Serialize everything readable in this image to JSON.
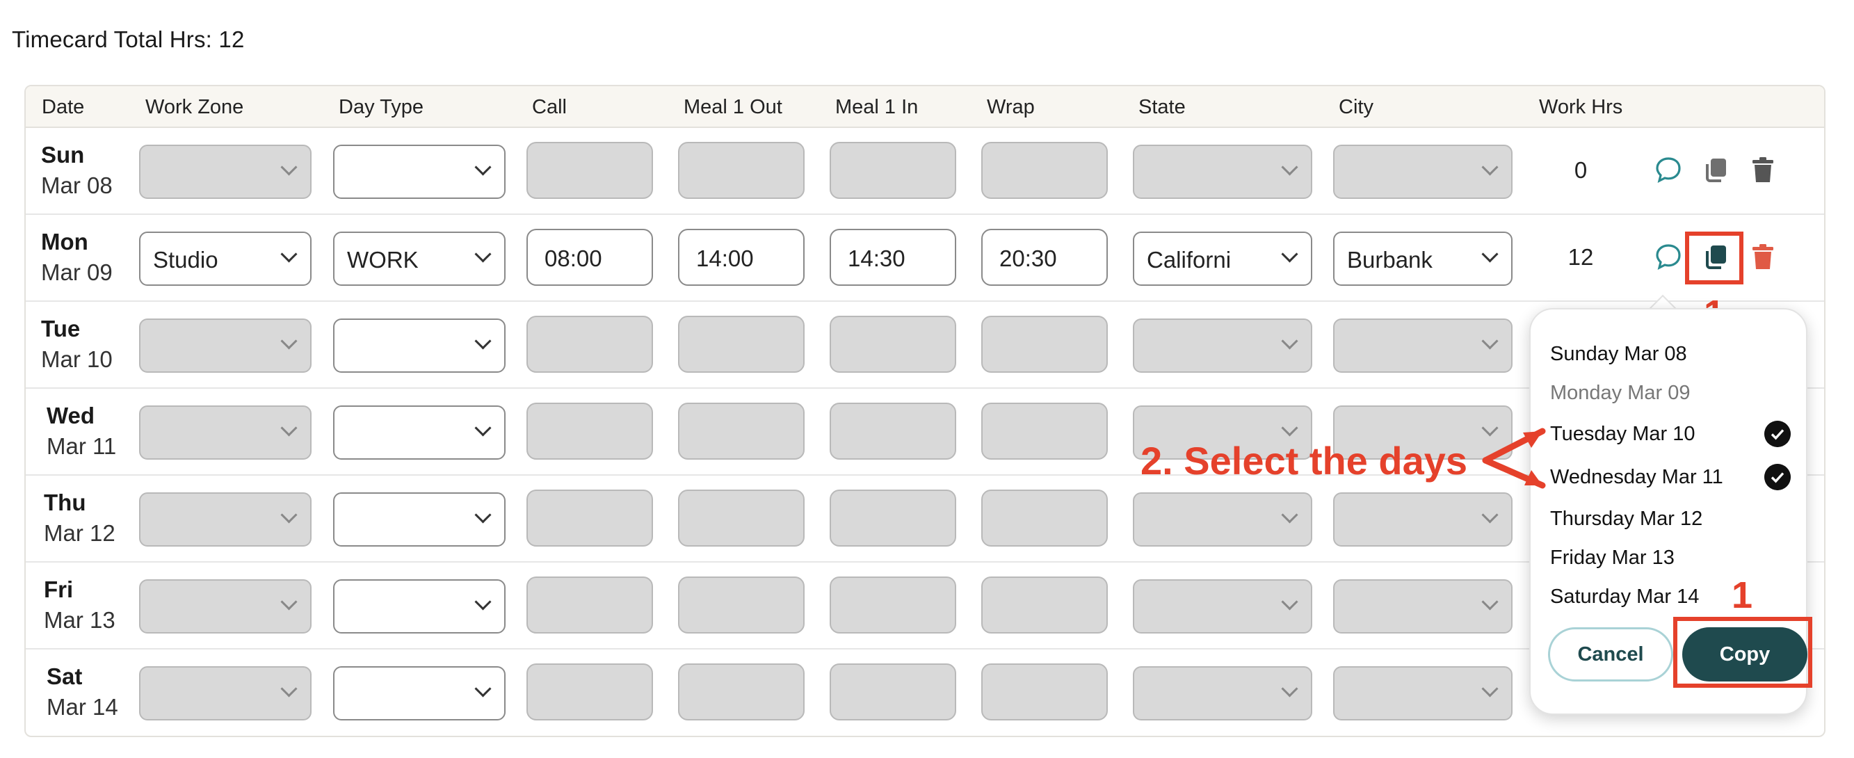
{
  "header": {
    "title": "Timecard Total Hrs: 12"
  },
  "columns": [
    "Date",
    "Work Zone",
    "Day Type",
    "Call",
    "Meal 1 Out",
    "Meal 1 In",
    "Wrap",
    "State",
    "City",
    "Work Hrs"
  ],
  "rows": [
    {
      "day": "Sun",
      "date": "Mar 08",
      "work_zone": "",
      "day_type": "",
      "call": "",
      "meal1_out": "",
      "meal1_in": "",
      "wrap": "",
      "state": "",
      "city": "",
      "work_hrs": "0"
    },
    {
      "day": "Mon",
      "date": "Mar 09",
      "work_zone": "Studio",
      "day_type": "WORK",
      "call": "08:00",
      "meal1_out": "14:00",
      "meal1_in": "14:30",
      "wrap": "20:30",
      "state": "Californi",
      "city": "Burbank",
      "work_hrs": "12"
    },
    {
      "day": "Tue",
      "date": "Mar 10"
    },
    {
      "day": "Wed",
      "date": "Mar 11"
    },
    {
      "day": "Thu",
      "date": "Mar 12"
    },
    {
      "day": "Fri",
      "date": "Mar 13"
    },
    {
      "day": "Sat",
      "date": "Mar 14"
    }
  ],
  "copy_popover": {
    "options": [
      {
        "label": "Sunday Mar 08",
        "checked": false,
        "disabled": false
      },
      {
        "label": "Monday Mar 09",
        "checked": false,
        "disabled": true
      },
      {
        "label": "Tuesday Mar 10",
        "checked": true,
        "disabled": false
      },
      {
        "label": "Wednesday Mar 11",
        "checked": true,
        "disabled": false
      },
      {
        "label": "Thursday Mar 12",
        "checked": false,
        "disabled": false
      },
      {
        "label": "Friday Mar 13",
        "checked": false,
        "disabled": false
      },
      {
        "label": "Saturday Mar 14",
        "checked": false,
        "disabled": false
      }
    ],
    "cancel_label": "Cancel",
    "copy_label": "Copy"
  },
  "annotations": {
    "step1_label": "1",
    "step1b_label": "1",
    "step2_label": "2. Select the days"
  },
  "colors": {
    "brand_teal": "#1f4a4e",
    "comment_icon": "#2a8a8f",
    "delete_icon_active": "#e05a45",
    "annotation_red": "#e5412b"
  },
  "icons": [
    "comment-icon",
    "copy-icon",
    "trash-icon",
    "chevron-down-icon",
    "check-icon"
  ]
}
